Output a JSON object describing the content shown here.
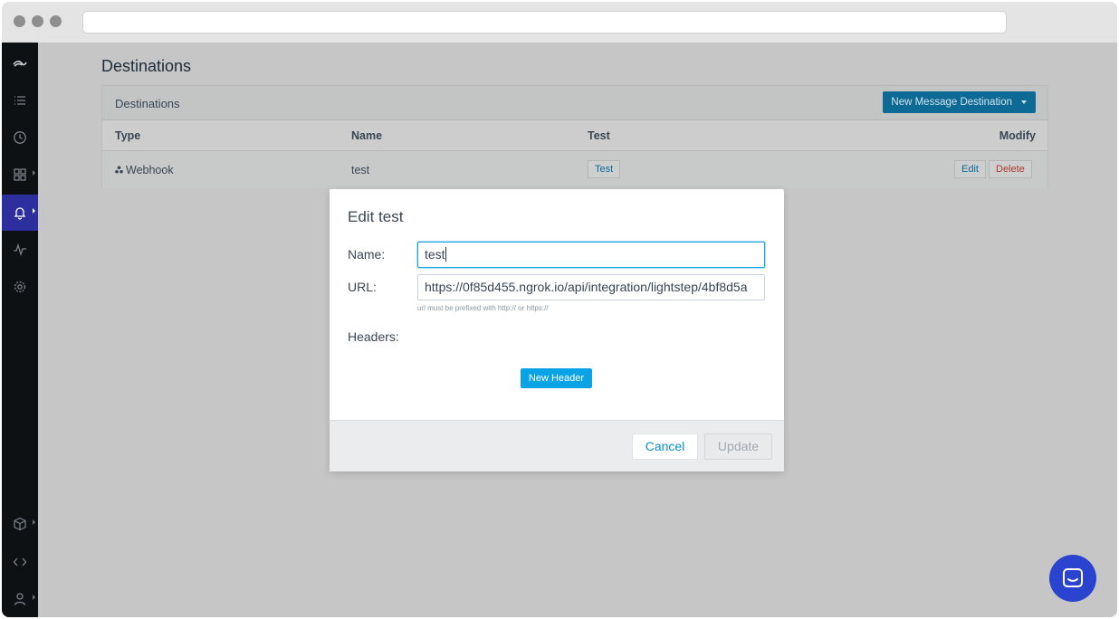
{
  "page": {
    "title": "Destinations"
  },
  "panel": {
    "title": "Destinations",
    "new_button": "New Message Destination",
    "columns": {
      "type": "Type",
      "name": "Name",
      "test": "Test",
      "modify": "Modify"
    },
    "row": {
      "type": "Webhook",
      "name": "test",
      "test_button": "Test",
      "edit_button": "Edit",
      "delete_button": "Delete"
    }
  },
  "modal": {
    "title": "Edit test",
    "name_label": "Name:",
    "name_value": "test",
    "url_label": "URL:",
    "url_value": "https://0f85d455.ngrok.io/api/integration/lightstep/4bf8d5a",
    "url_hint": "url must be prefixed with http:// or https://",
    "headers_label": "Headers:",
    "new_header_button": "New Header",
    "cancel_button": "Cancel",
    "update_button": "Update"
  },
  "colors": {
    "sidebar_active": "#2d2f9f",
    "primary": "#0aa3e6",
    "delete": "#c0392b",
    "chat": "#2a44cf"
  }
}
